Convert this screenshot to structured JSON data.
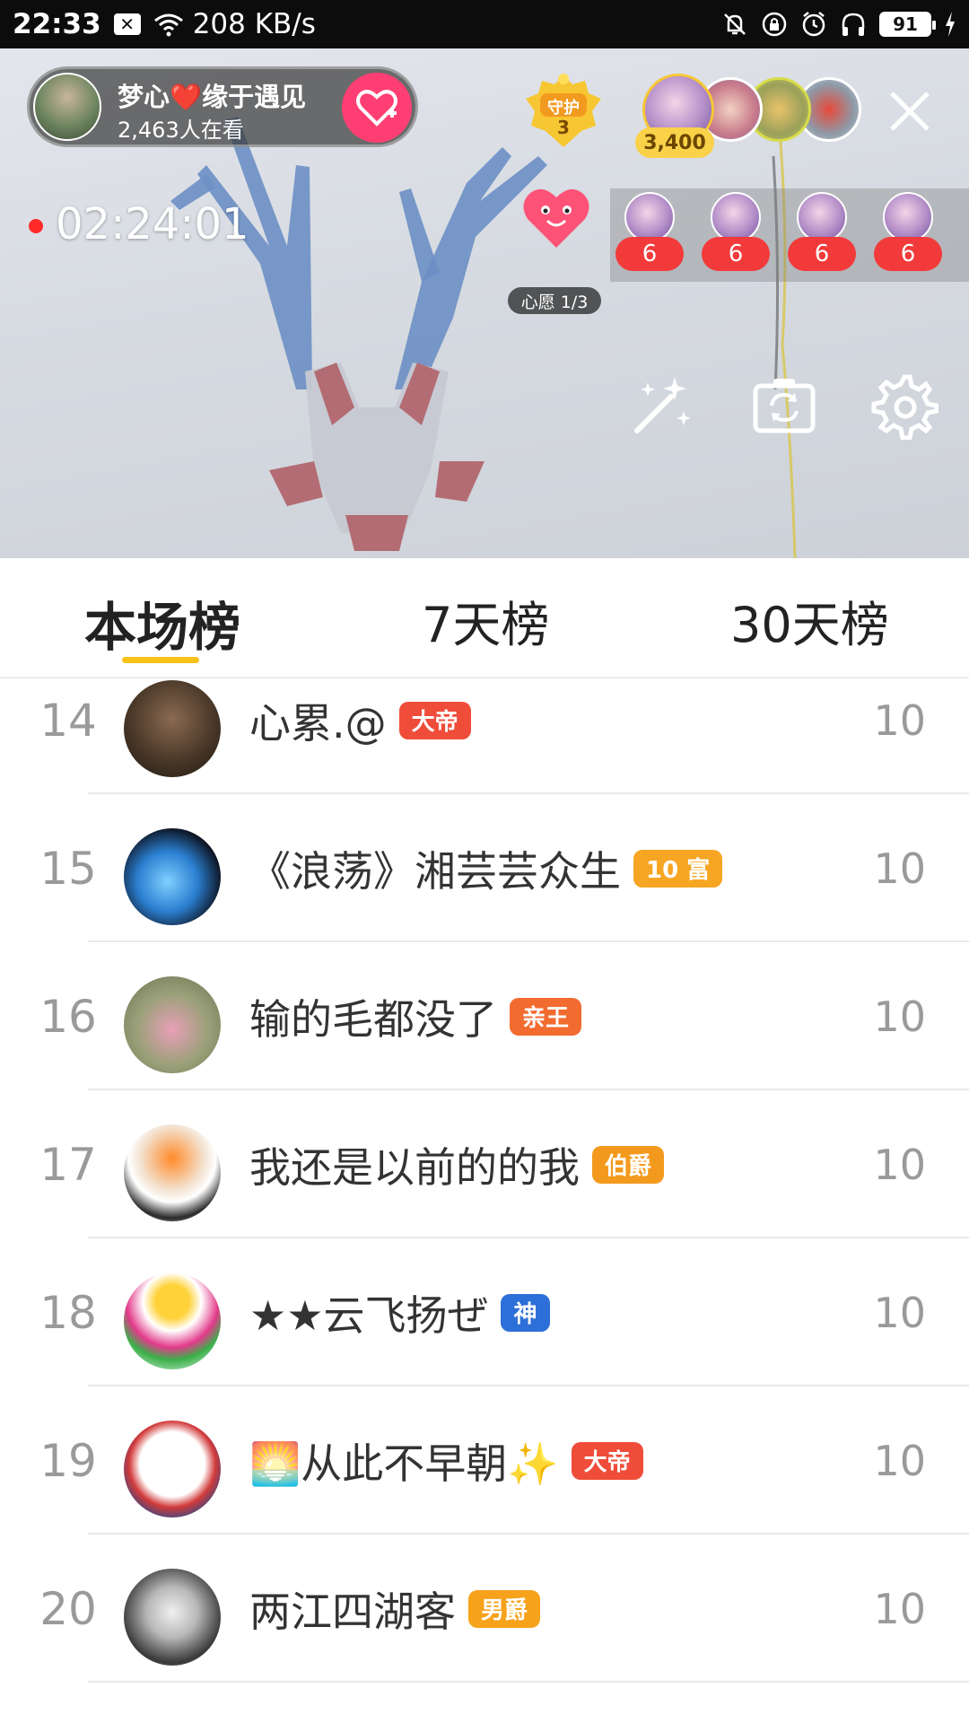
{
  "status_bar": {
    "time": "22:33",
    "speed": "208 KB/s",
    "battery": "91"
  },
  "anchor": {
    "name": "梦心❤️缘于遇见",
    "viewer_count": "2,463人在看"
  },
  "guard": {
    "label": "守护",
    "count": "3"
  },
  "top_viewers": {
    "score": "3,400"
  },
  "live": {
    "duration": "02:24:01"
  },
  "wish": {
    "label": "心愿 1/3"
  },
  "fans": [
    {
      "level": "6"
    },
    {
      "level": "6"
    },
    {
      "level": "6"
    },
    {
      "level": "6"
    }
  ],
  "tabs": [
    {
      "label": "本场榜",
      "active": true
    },
    {
      "label": "7天榜",
      "active": false
    },
    {
      "label": "30天榜",
      "active": false
    }
  ],
  "ranking": [
    {
      "rank": "14",
      "name": "心累.@",
      "badge": "大帝",
      "badge_color": "#ef4d3a",
      "score": "10"
    },
    {
      "rank": "15",
      "name": "《浪荡》湘芸芸众生",
      "badge": "10 富",
      "badge_color": "#f6a623",
      "score": "10"
    },
    {
      "rank": "16",
      "name": "输的毛都没了",
      "badge": "亲王",
      "badge_color": "#f26b2f",
      "score": "10"
    },
    {
      "rank": "17",
      "name": "我还是以前的的我",
      "badge": "伯爵",
      "badge_color": "#f39a1e",
      "score": "10"
    },
    {
      "rank": "18",
      "name": "★★云飞扬ぜ",
      "badge": "神",
      "badge_color": "#2d6fd8",
      "score": "10"
    },
    {
      "rank": "19",
      "name": "🌅从此不早朝✨",
      "badge": "大帝",
      "badge_color": "#ef4d3a",
      "score": "10"
    },
    {
      "rank": "20",
      "name": "两江四湖客",
      "badge": "男爵",
      "badge_color": "#f7a21b",
      "score": "10"
    }
  ]
}
